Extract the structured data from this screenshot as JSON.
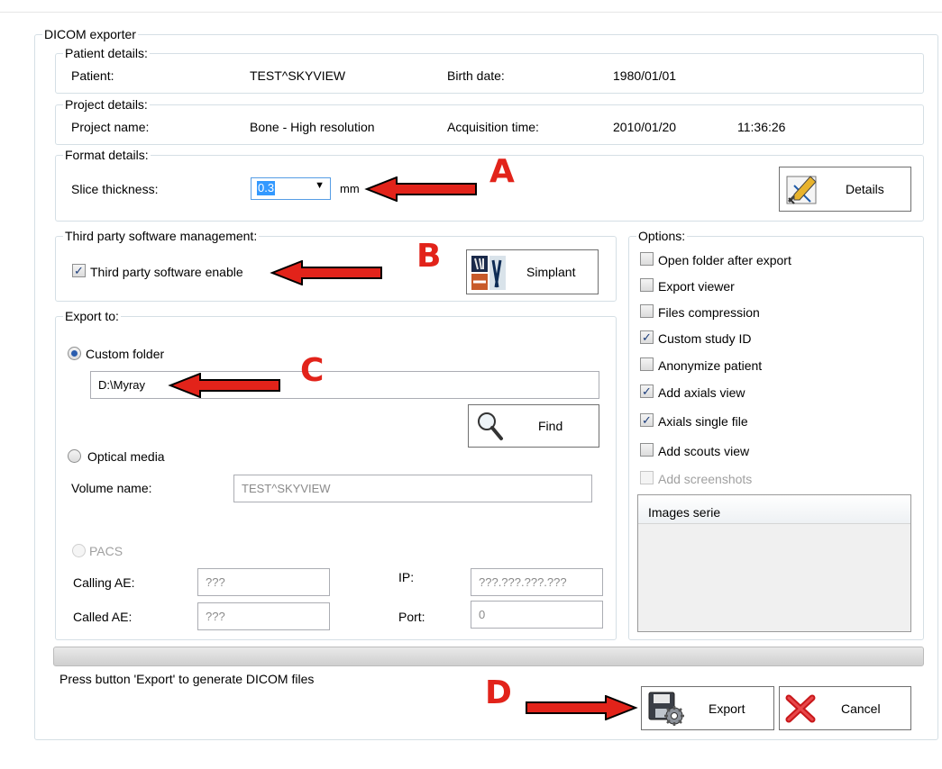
{
  "window": {
    "title": "DICOM exporter"
  },
  "patient": {
    "group_label": "Patient details:",
    "patient_label": "Patient:",
    "patient_value": "TEST^SKYVIEW",
    "birth_label": "Birth date:",
    "birth_value": "1980/01/01"
  },
  "project": {
    "group_label": "Project details:",
    "name_label": "Project name:",
    "name_value": "Bone - High resolution",
    "acq_label": "Acquisition time:",
    "acq_date": "2010/01/20",
    "acq_time": "11:36:26"
  },
  "format": {
    "group_label": "Format details:",
    "slice_label": "Slice thickness:",
    "slice_value": "0.3",
    "unit": "mm",
    "details_button": "Details"
  },
  "third_party": {
    "group_label": "Third party software management:",
    "enable_label": "Third party software enable",
    "enable_checked": true,
    "simplant_button": "Simplant"
  },
  "export_to": {
    "group_label": "Export to:",
    "custom_folder_label": "Custom folder",
    "custom_folder_selected": true,
    "folder_path": "D:\\Myray",
    "find_button": "Find",
    "optical_label": "Optical media",
    "volume_label": "Volume name:",
    "volume_value": "TEST^SKYVIEW",
    "pacs_label": "PACS",
    "calling_ae_label": "Calling AE:",
    "calling_ae_value": "???",
    "called_ae_label": "Called AE:",
    "called_ae_value": "???",
    "ip_label": "IP:",
    "ip_value": "???.???.???.???",
    "port_label": "Port:",
    "port_value": "0"
  },
  "options": {
    "group_label": "Options:",
    "items": [
      {
        "label": "Open folder after export",
        "checked": false,
        "disabled": false
      },
      {
        "label": "Export viewer",
        "checked": false,
        "disabled": false
      },
      {
        "label": "Files compression",
        "checked": false,
        "disabled": false
      },
      {
        "label": "Custom study ID",
        "checked": true,
        "disabled": false
      },
      {
        "label": "Anonymize patient",
        "checked": false,
        "disabled": false
      },
      {
        "label": "Add axials view",
        "checked": true,
        "disabled": false
      },
      {
        "label": "Axials single file",
        "checked": true,
        "disabled": false
      },
      {
        "label": "Add scouts view",
        "checked": false,
        "disabled": false
      },
      {
        "label": "Add screenshots",
        "checked": false,
        "disabled": true
      }
    ],
    "images_serie_header": "Images serie"
  },
  "footer": {
    "status_text": "Press button 'Export' to generate DICOM files",
    "export_button": "Export",
    "cancel_button": "Cancel"
  },
  "annotations": {
    "marker_a": "A",
    "marker_b": "B",
    "marker_c": "C",
    "marker_d": "D",
    "arrow_color": "#e2231a"
  }
}
